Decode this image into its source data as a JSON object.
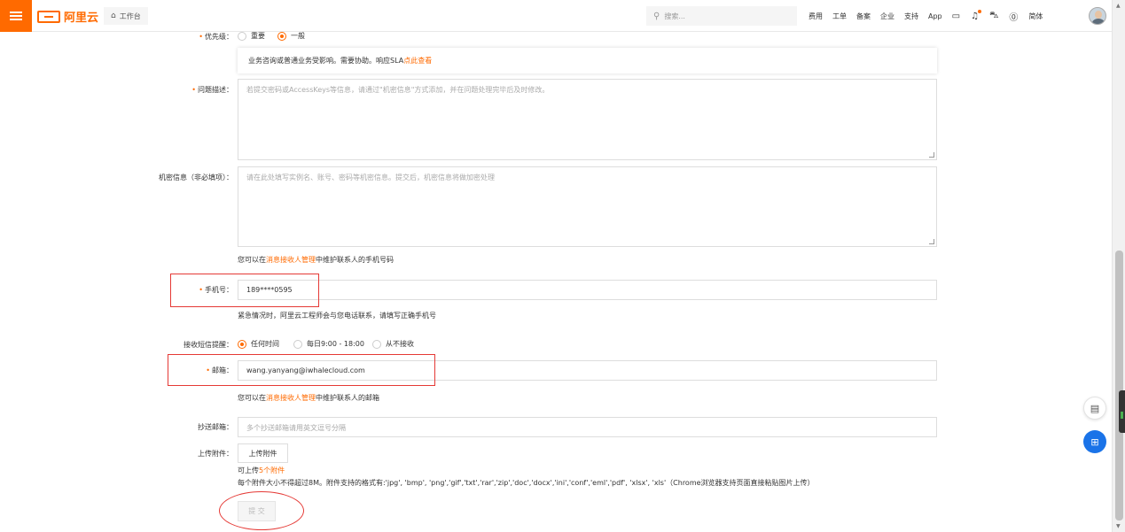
{
  "brand": {
    "name": "阿里云",
    "accent": "#ff6a00"
  },
  "topbar": {
    "workbench": "工作台",
    "search_placeholder": "搜索...",
    "nav": [
      "费用",
      "工单",
      "备案",
      "企业",
      "支持",
      "App"
    ],
    "language": "简体",
    "icons": [
      "terminal-icon",
      "bell-icon",
      "cart-icon",
      "help-icon"
    ]
  },
  "form": {
    "priority": {
      "label": "优先级：",
      "options": [
        "重要",
        "一般"
      ],
      "selected": "一般",
      "sla_text": "业务咨询或普通业务受影响。需要协助。响应SLA",
      "sla_link": "点此查看"
    },
    "description": {
      "label": "问题描述：",
      "placeholder": "若提交密码或AccessKeys等信息，请通过\"机密信息\"方式添加，并在问题处理完毕后及时修改。"
    },
    "secret": {
      "label": "机密信息（非必填项）：",
      "placeholder": "请在此处填写实例名、账号、密码等机密信息。提交后，机密信息将做加密处理"
    },
    "phone_hint": {
      "before": "您可以在",
      "link": "消息接收人管理",
      "after": "中维护联系人的手机号码"
    },
    "phone": {
      "label": "手机号：",
      "value": "189****0595",
      "note": "紧急情况时，阿里云工程师会与您电话联系，请填写正确手机号"
    },
    "sms": {
      "label": "接收短信提醒：",
      "options": [
        "任何时间",
        "每日9:00 - 18:00",
        "从不接收"
      ],
      "selected": "任何时间"
    },
    "email": {
      "label": "邮箱：",
      "value": "wang.yanyang@iwhalecloud.com",
      "hint_before": "您可以在",
      "hint_link": "消息接收人管理",
      "hint_after": "中维护联系人的邮箱"
    },
    "cc": {
      "label": "抄送邮箱：",
      "placeholder": "多个抄送邮箱请用英文逗号分隔"
    },
    "attachment": {
      "label": "上传附件：",
      "button": "上传附件",
      "limit_before": "可上传",
      "limit_link": "5个附件",
      "rules": "每个附件大小不得超过8M。附件支持的格式有:'jpg', 'bmp', 'png','gif','txt','rar','zip','doc','docx','ini','conf','eml','pdf', 'xlsx', 'xls'（Chrome浏览器支持页面直接粘贴图片上传）"
    },
    "submit": "提 交"
  }
}
